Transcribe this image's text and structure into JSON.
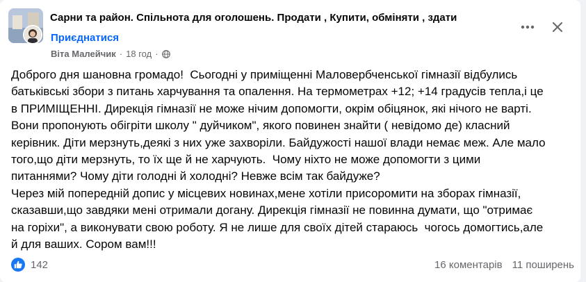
{
  "post": {
    "group_name": "Сарни та район. Спільнота для оголошень. Продати , Купити, обміняти , здати",
    "join_label": "Приєднатися",
    "author": "Віта Малейчик",
    "time": "18 год",
    "separator": "·",
    "text": "Доброго дня шановна громадо!  Сьогодні у приміщенні Маловербченської гімназії відбулись\nбатьківські збори з питань харчування та опалення. На термометрах +12; +14 градусів тепла,і це\nв ПРИМІЩЕННІ. Дирекція гімназії не може нічим допомогти, окрім обіцянок, які нічого не варті.\nВони пропонують обігріти школу \" дуйчиком\", якого повинен знайти ( невідомо де) класний\nкерівник. Діти мерзнуть,деякі з них уже захворіли. Байдужості нашої влади немає меж. Але мало\nтого,що діти мерзнуть, то їх ще й не харчують.  Чому ніхто не може допомогти з цими\nпитаннями? Чому діти голодні й холодні? Невже всім так байдуже?\nЧерез мій попередній допис у місцевих новинах,мене хотіли присоромити на зборах гімназії,\nсказавши,що завдяки мені отримали догану. Дирекція гімназії не повинна думати, що \"отримає\nна горіхи\", а виконувати свою роботу. Я не лише для своїх дітей стараюсь  чогось домогтись,але\nй для ваших. Сором вам!!!",
    "reactions_count": "142",
    "comments": "16 коментарів",
    "shares": "11 поширень"
  },
  "icons": {
    "more": "more-horizontal-icon",
    "close": "close-icon",
    "privacy": "globe-icon",
    "reaction": "like-icon"
  },
  "colors": {
    "link": "#0866ff",
    "like": "#1877f2",
    "secondary_text": "#65676b"
  }
}
